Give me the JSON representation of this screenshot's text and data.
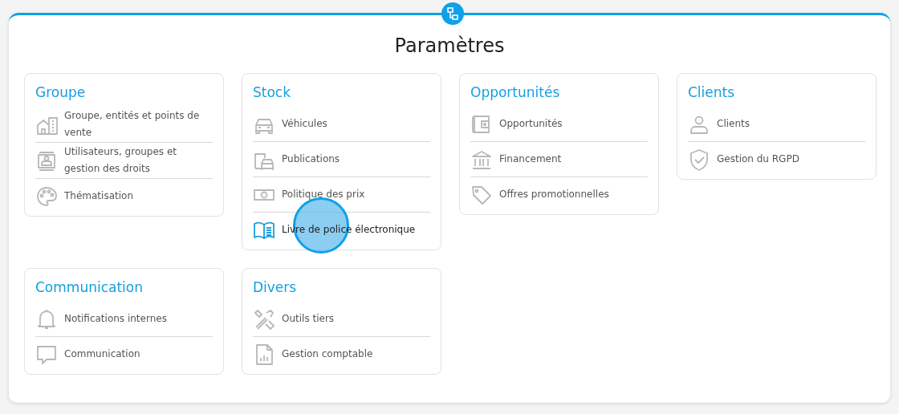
{
  "title": "Paramètres",
  "sections": [
    {
      "heading": "Groupe",
      "items": [
        {
          "label": "Groupe, entités et points de vente",
          "active": false
        },
        {
          "label": "Utilisateurs, groupes et gestion des droits",
          "active": false
        },
        {
          "label": "Thématisation",
          "active": false
        }
      ]
    },
    {
      "heading": "Stock",
      "items": [
        {
          "label": "Véhicules",
          "active": false
        },
        {
          "label": "Publications",
          "active": false
        },
        {
          "label": "Politique des prix",
          "active": false
        },
        {
          "label": "Livre de police électronique",
          "active": true
        }
      ]
    },
    {
      "heading": "Opportunités",
      "items": [
        {
          "label": "Opportunités",
          "active": false
        },
        {
          "label": "Financement",
          "active": false
        },
        {
          "label": "Offres promotionnelles",
          "active": false
        }
      ]
    },
    {
      "heading": "Clients",
      "items": [
        {
          "label": "Clients",
          "active": false
        },
        {
          "label": "Gestion du RGPD",
          "active": false
        }
      ]
    },
    {
      "heading": "Communication",
      "items": [
        {
          "label": "Notifications internes",
          "active": false
        },
        {
          "label": "Communication",
          "active": false
        }
      ]
    },
    {
      "heading": "Divers",
      "items": [
        {
          "label": "Outils tiers",
          "active": false
        },
        {
          "label": "Gestion comptable",
          "active": false
        }
      ]
    }
  ]
}
